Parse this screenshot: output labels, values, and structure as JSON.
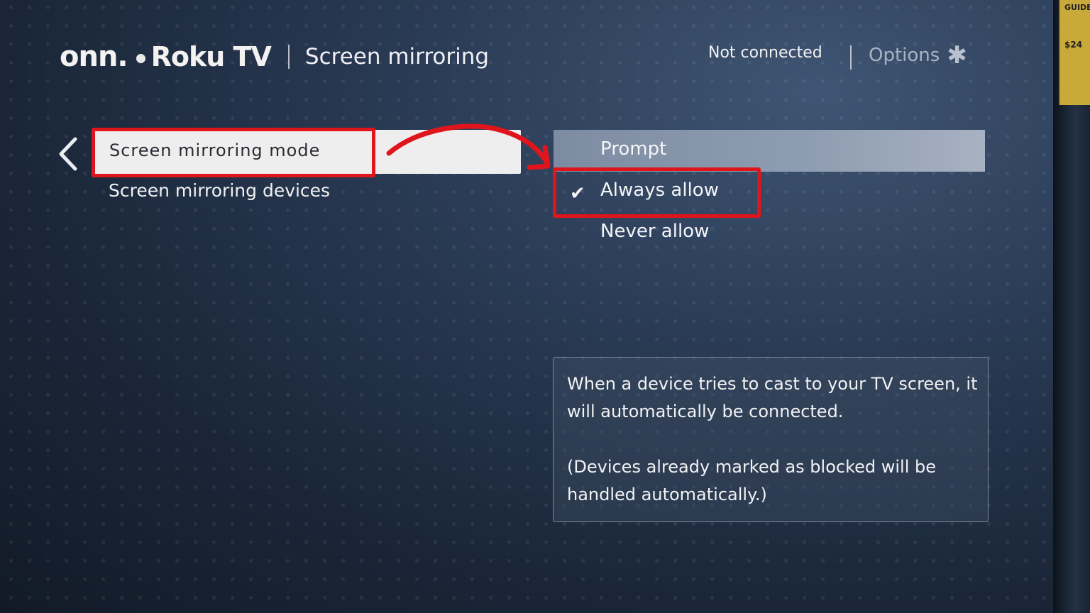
{
  "header": {
    "brand_onn": "onn.",
    "brand_roku": "Roku TV",
    "page_title": "Screen mirroring",
    "status": "Not connected",
    "options_label": "Options"
  },
  "left_menu": {
    "items": [
      {
        "label": "Screen mirroring mode",
        "selected": true
      },
      {
        "label": "Screen mirroring devices",
        "selected": false
      }
    ]
  },
  "mode_options": {
    "items": [
      {
        "label": "Prompt",
        "focused": true,
        "checked": false
      },
      {
        "label": "Always allow",
        "focused": false,
        "checked": true
      },
      {
        "label": "Never allow",
        "focused": false,
        "checked": false
      }
    ]
  },
  "description": {
    "paragraph_1": "When a device tries to cast to your TV screen, it will automatically be connected.",
    "paragraph_2": "(Devices already marked as blocked will be handled automatically.)"
  },
  "tv_sticker": {
    "top_text": "GUIDE",
    "price": "$24"
  },
  "icons": {
    "back": "chevron-left-icon",
    "options": "asterisk-icon",
    "check": "checkmark-icon"
  },
  "colors": {
    "annotation_red": "#e0151b",
    "highlight": "#8f9db2",
    "selected_bg": "#eeeeee"
  }
}
